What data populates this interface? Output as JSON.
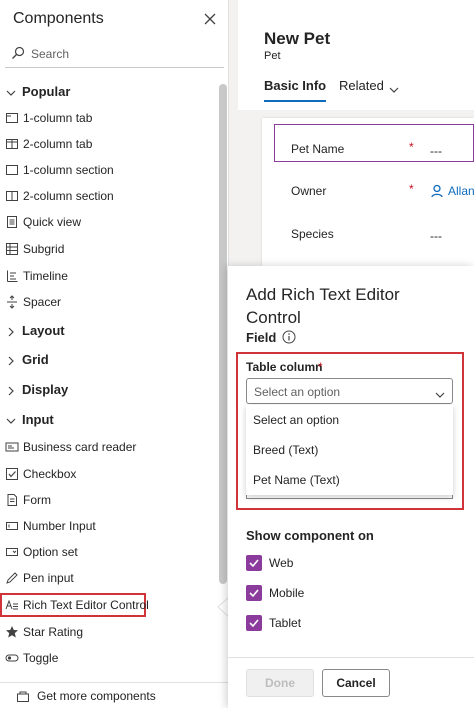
{
  "pane": {
    "title": "Components",
    "search_placeholder": "Search",
    "sections": {
      "popular": "Popular",
      "layout": "Layout",
      "grid": "Grid",
      "display": "Display",
      "input": "Input"
    },
    "popular_items": [
      "1-column tab",
      "2-column tab",
      "1-column section",
      "2-column section",
      "Quick view",
      "Subgrid",
      "Timeline",
      "Spacer"
    ],
    "input_items": [
      "Business card reader",
      "Checkbox",
      "Form",
      "Number Input",
      "Option set",
      "Pen input",
      "Rich Text Editor Control",
      "Star Rating",
      "Toggle"
    ],
    "footer_label": "Get more components"
  },
  "form": {
    "title": "New Pet",
    "subtitle": "Pet",
    "tabs": [
      "Basic Info",
      "Related"
    ],
    "fields": [
      {
        "label": "Pet Name",
        "required": "*",
        "value": "---"
      },
      {
        "label": "Owner",
        "required": "*",
        "value": "Allan"
      },
      {
        "label": "Species",
        "required": "",
        "value": "---"
      }
    ]
  },
  "dialog": {
    "title": "Add Rich Text Editor Control",
    "field_label": "Field",
    "table_column_label": "Table column",
    "table_column_required": "*",
    "select_placeholder": "Select an option",
    "options": [
      "Select an option",
      "Breed (Text)",
      "Pet Name (Text)"
    ],
    "show_on_label": "Show component on",
    "checkboxes": [
      {
        "label": "Web",
        "checked": true
      },
      {
        "label": "Mobile",
        "checked": true
      },
      {
        "label": "Tablet",
        "checked": true
      }
    ],
    "done_label": "Done",
    "cancel_label": "Cancel"
  },
  "colors": {
    "accent_purple": "#8b3b9c",
    "highlight_red": "#d13438",
    "link_blue": "#0f6cbd",
    "required_red": "#c50f1f"
  }
}
